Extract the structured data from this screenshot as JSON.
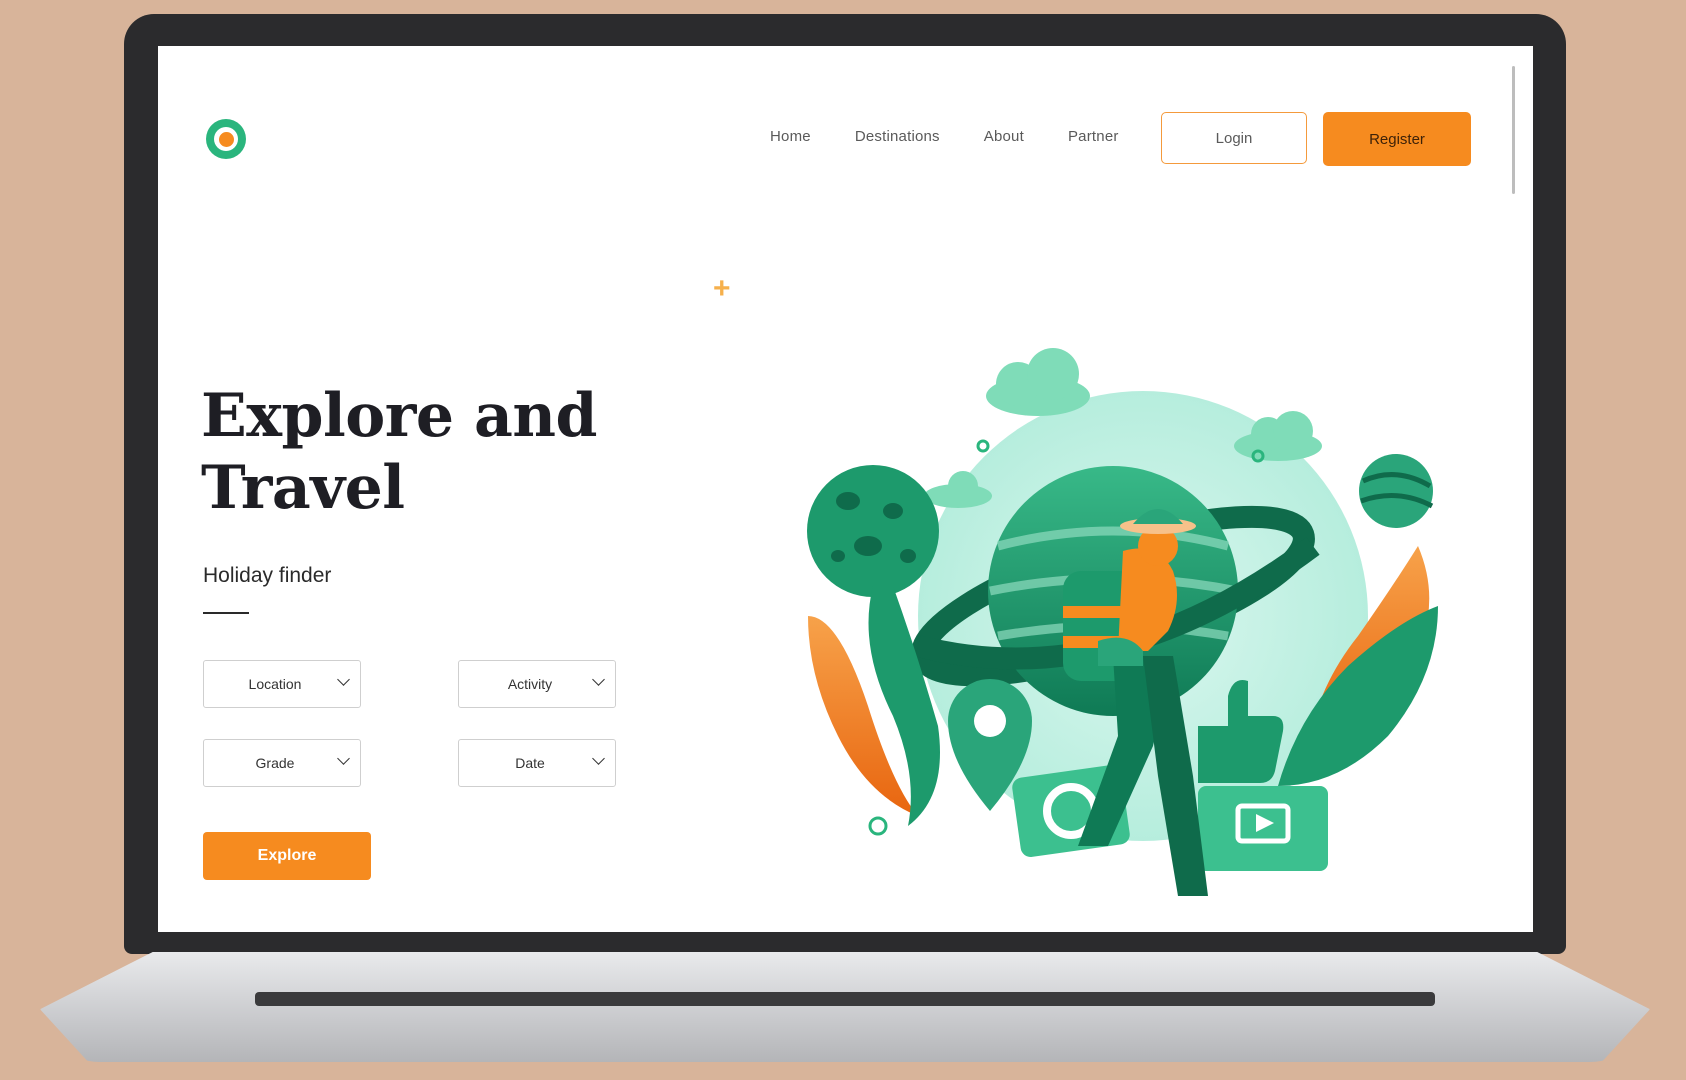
{
  "nav": {
    "links": [
      "Home",
      "Destinations",
      "About",
      "Partner"
    ],
    "login_label": "Login",
    "register_label": "Register"
  },
  "hero": {
    "title_line1": "Explore and",
    "title_line2": "Travel",
    "subtitle": "Holiday finder"
  },
  "filters": {
    "location": "Location",
    "activity": "Activity",
    "grade": "Grade",
    "date": "Date"
  },
  "explore_label": "Explore",
  "colors": {
    "brand_green": "#2ab57d",
    "brand_orange": "#f68b1f",
    "background": "#d8b49a"
  },
  "icons": [
    "logo-icon",
    "chevron-down-icon",
    "sparkle-icon"
  ]
}
